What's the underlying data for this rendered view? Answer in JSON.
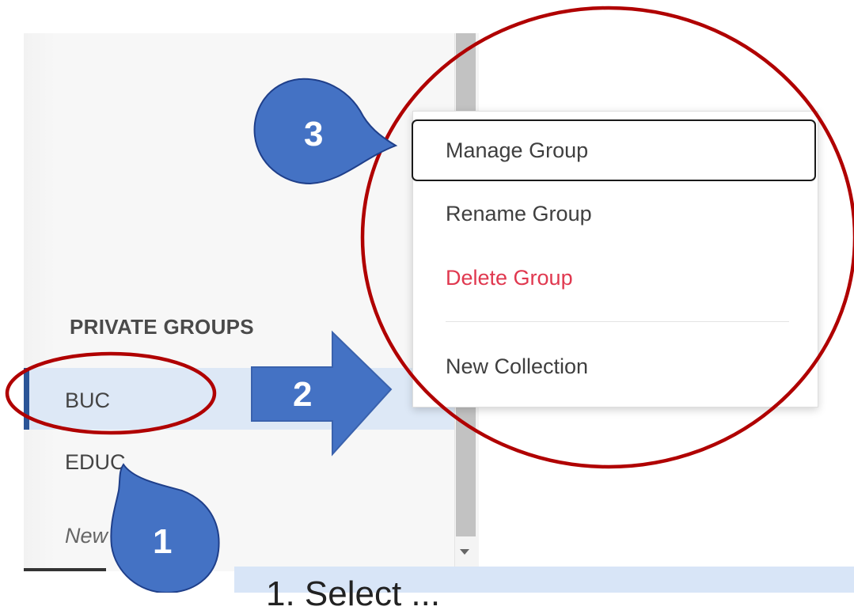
{
  "sidebar": {
    "section_heading": "PRIVATE GROUPS",
    "groups": [
      {
        "label": "BUC",
        "selected": true
      },
      {
        "label": "EDUC",
        "selected": false
      }
    ],
    "new_group_label": "New"
  },
  "context_menu": {
    "items": [
      {
        "label": "Manage Group",
        "focused": true
      },
      {
        "label": "Rename Group"
      },
      {
        "label": "Delete Group",
        "style": "danger"
      },
      {
        "label": "New Collection"
      }
    ]
  },
  "annotations": {
    "step_1": "1",
    "step_2": "2",
    "step_3": "3",
    "callout_color": "#4472c4",
    "circle_color": "#b00000"
  },
  "caption": "1. Select ..."
}
